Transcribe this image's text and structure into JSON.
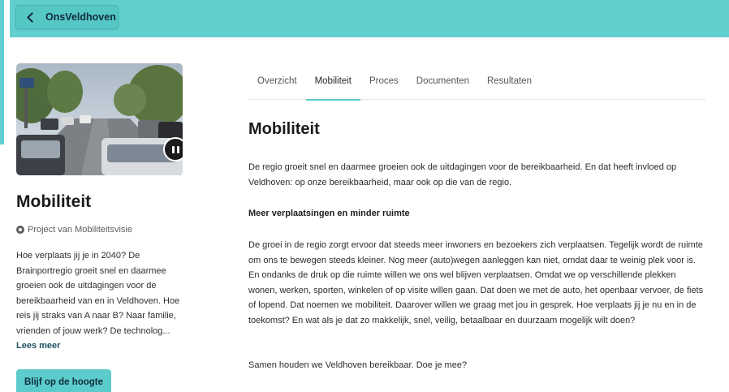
{
  "header": {
    "back_label": "OnsVeldhoven",
    "accent_color": "#62cfcf"
  },
  "sidebar": {
    "title": "Mobiliteit",
    "project_label": "Project van Mobiliteitsvisie",
    "description": "Hoe verplaats jij je in 2040? De Brainportregio groeit snel en daarmee groeien ook de uitdagingen voor de bereikbaarheid van en in Veldhoven. Hoe reis jij straks van A naar B? Naar familie, vrienden of jouw werk? De technolog...",
    "read_more": "Lees meer",
    "subscribe_button": "Blijf op de hoogte"
  },
  "tabs": [
    {
      "label": "Overzicht",
      "active": false
    },
    {
      "label": "Mobiliteit",
      "active": true
    },
    {
      "label": "Proces",
      "active": false
    },
    {
      "label": "Documenten",
      "active": false
    },
    {
      "label": "Resultaten",
      "active": false
    }
  ],
  "content": {
    "title": "Mobiliteit",
    "intro": "De regio groeit snel en daarmee groeien ook de uitdagingen voor de bereikbaarheid. En dat heeft invloed op Veldhoven: op onze bereikbaarheid, maar ook op die van de regio.",
    "subheading": "Meer verplaatsingen en minder ruimte",
    "body": "De groei in de regio zorgt ervoor dat steeds meer inwoners en bezoekers zich verplaatsen. Tegelijk wordt de ruimte om ons te bewegen steeds kleiner. Nog meer (auto)wegen aanleggen kan niet, omdat daar te weinig plek voor is. En ondanks de druk op die ruimte willen we ons wel blijven verplaatsen. Omdat we op verschillende plekken wonen, werken, sporten, winkelen of op visite willen gaan. Dat doen we met de auto, het openbaar vervoer, de fiets of lopend. Dat noemen we mobiliteit. Daarover willen we graag met jou in gesprek. Hoe verplaats jij je nu en in de toekomst? En wat als je dat zo makkelijk, snel, veilig, betaalbaar en duurzaam mogelijk wilt doen?",
    "closing": "Samen houden we Veldhoven bereikbaar. Doe je mee?"
  }
}
